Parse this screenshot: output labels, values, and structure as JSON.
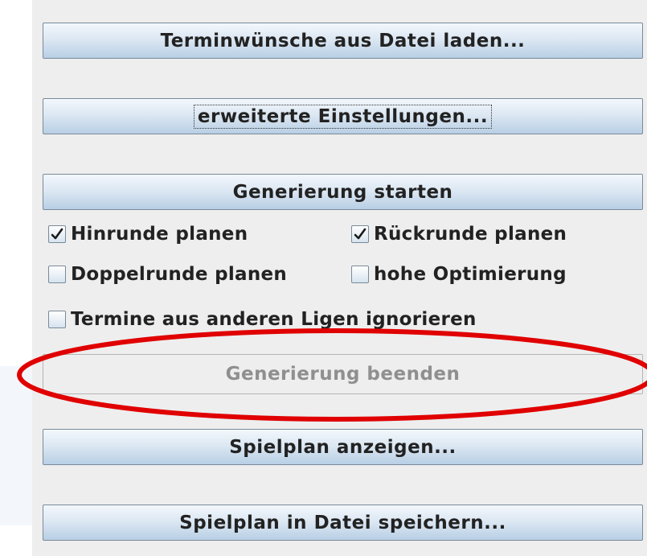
{
  "buttons": {
    "load_wishes": "Terminwünsche aus Datei laden...",
    "advanced_settings": "erweiterte Einstellungen...",
    "start_generation": "Generierung starten",
    "stop_generation": "Generierung beenden",
    "show_schedule": "Spielplan anzeigen...",
    "save_schedule": "Spielplan in Datei speichern..."
  },
  "options": {
    "first_round": {
      "label": "Hinrunde planen",
      "checked": true
    },
    "second_round": {
      "label": "Rückrunde planen",
      "checked": true
    },
    "double_round": {
      "label": "Doppelrunde planen",
      "checked": false
    },
    "high_optimization": {
      "label": "hohe Optimierung",
      "checked": false
    },
    "ignore_other_leagues": {
      "label": "Termine aus anderen Ligen ignorieren",
      "checked": false
    }
  },
  "colors": {
    "panel_background": "#eeeeee",
    "button_border": "#7a8a99",
    "disabled_text": "#8f8f8f",
    "highlight_ellipse": "#e00000"
  }
}
